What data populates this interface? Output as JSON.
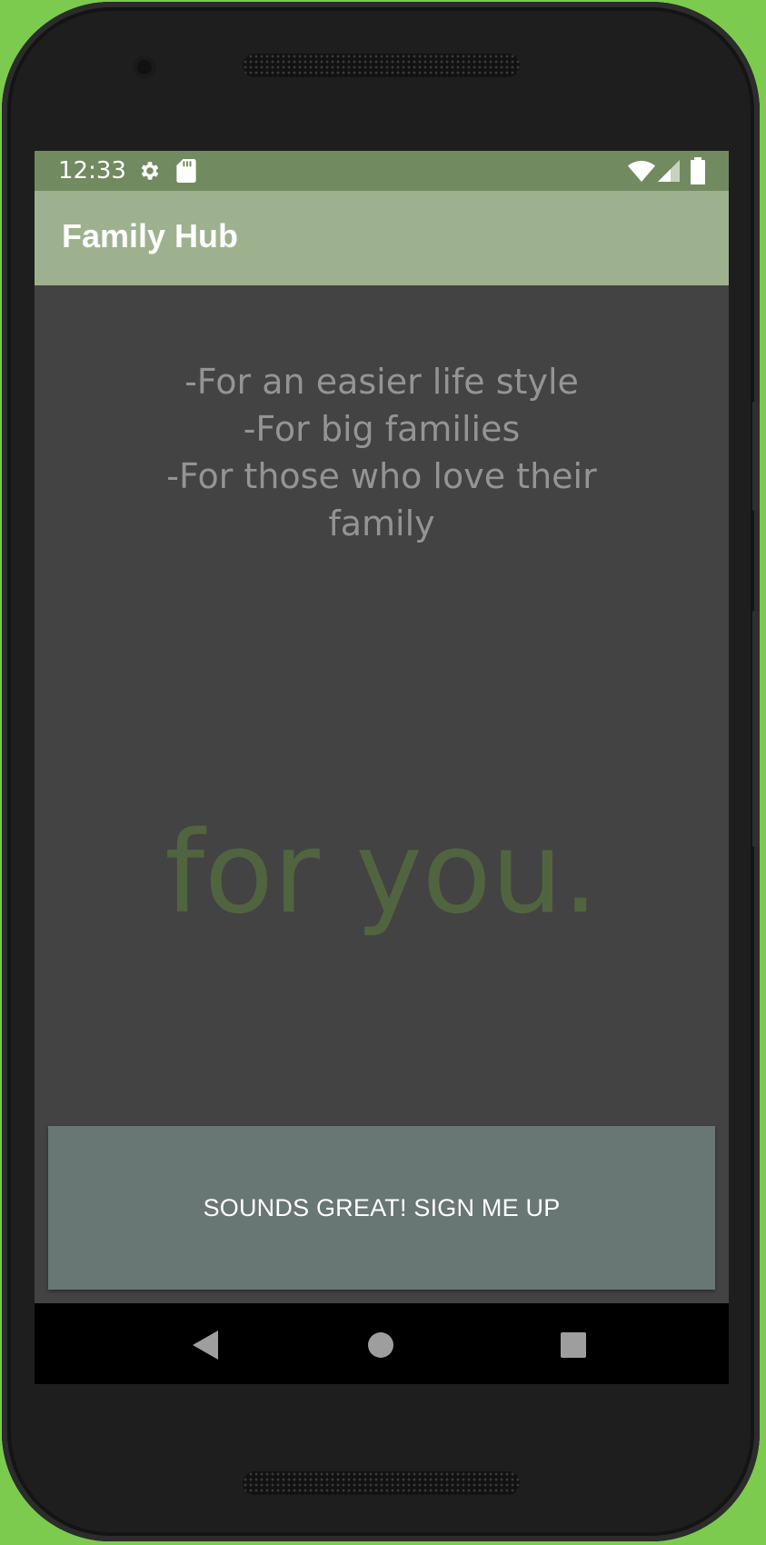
{
  "status_bar": {
    "time": "12:33",
    "icons": [
      "settings-gear-icon",
      "sd-card-icon",
      "wifi-icon",
      "cellular-signal-icon",
      "battery-icon"
    ]
  },
  "app_bar": {
    "title": "Family Hub"
  },
  "content": {
    "taglines": [
      "-For an easier life style",
      "-For big families",
      "-For those who love their family"
    ],
    "hero_text": "for you."
  },
  "signup_button": {
    "label": "SOUNDS GREAT! SIGN ME UP"
  },
  "nav_bar": {
    "icons": [
      "back-triangle-icon",
      "home-circle-icon",
      "recents-square-icon"
    ]
  },
  "colors": {
    "device_background": "#7ccb4e",
    "status_bar": "#728a60",
    "app_bar": "#9eb18f",
    "screen_background": "#434343",
    "tagline_text": "#949494",
    "hero_text": "#50653f",
    "button_background": "#687674"
  }
}
